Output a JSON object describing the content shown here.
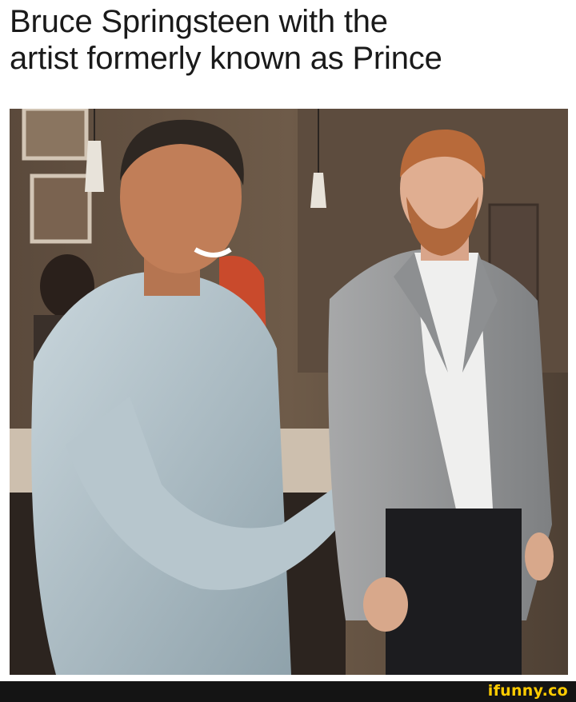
{
  "caption": {
    "line1": "Bruce Springsteen with the",
    "line2": "artist formerly known as Prince"
  },
  "footer": {
    "brand": "ifunny.co",
    "brand_color": "#ffcc00"
  },
  "photo": {
    "subject_left": "smiling man in light blue denim shirt, hands clasped",
    "subject_right": "red-haired bearded man in light grey blazer and white shirt"
  }
}
